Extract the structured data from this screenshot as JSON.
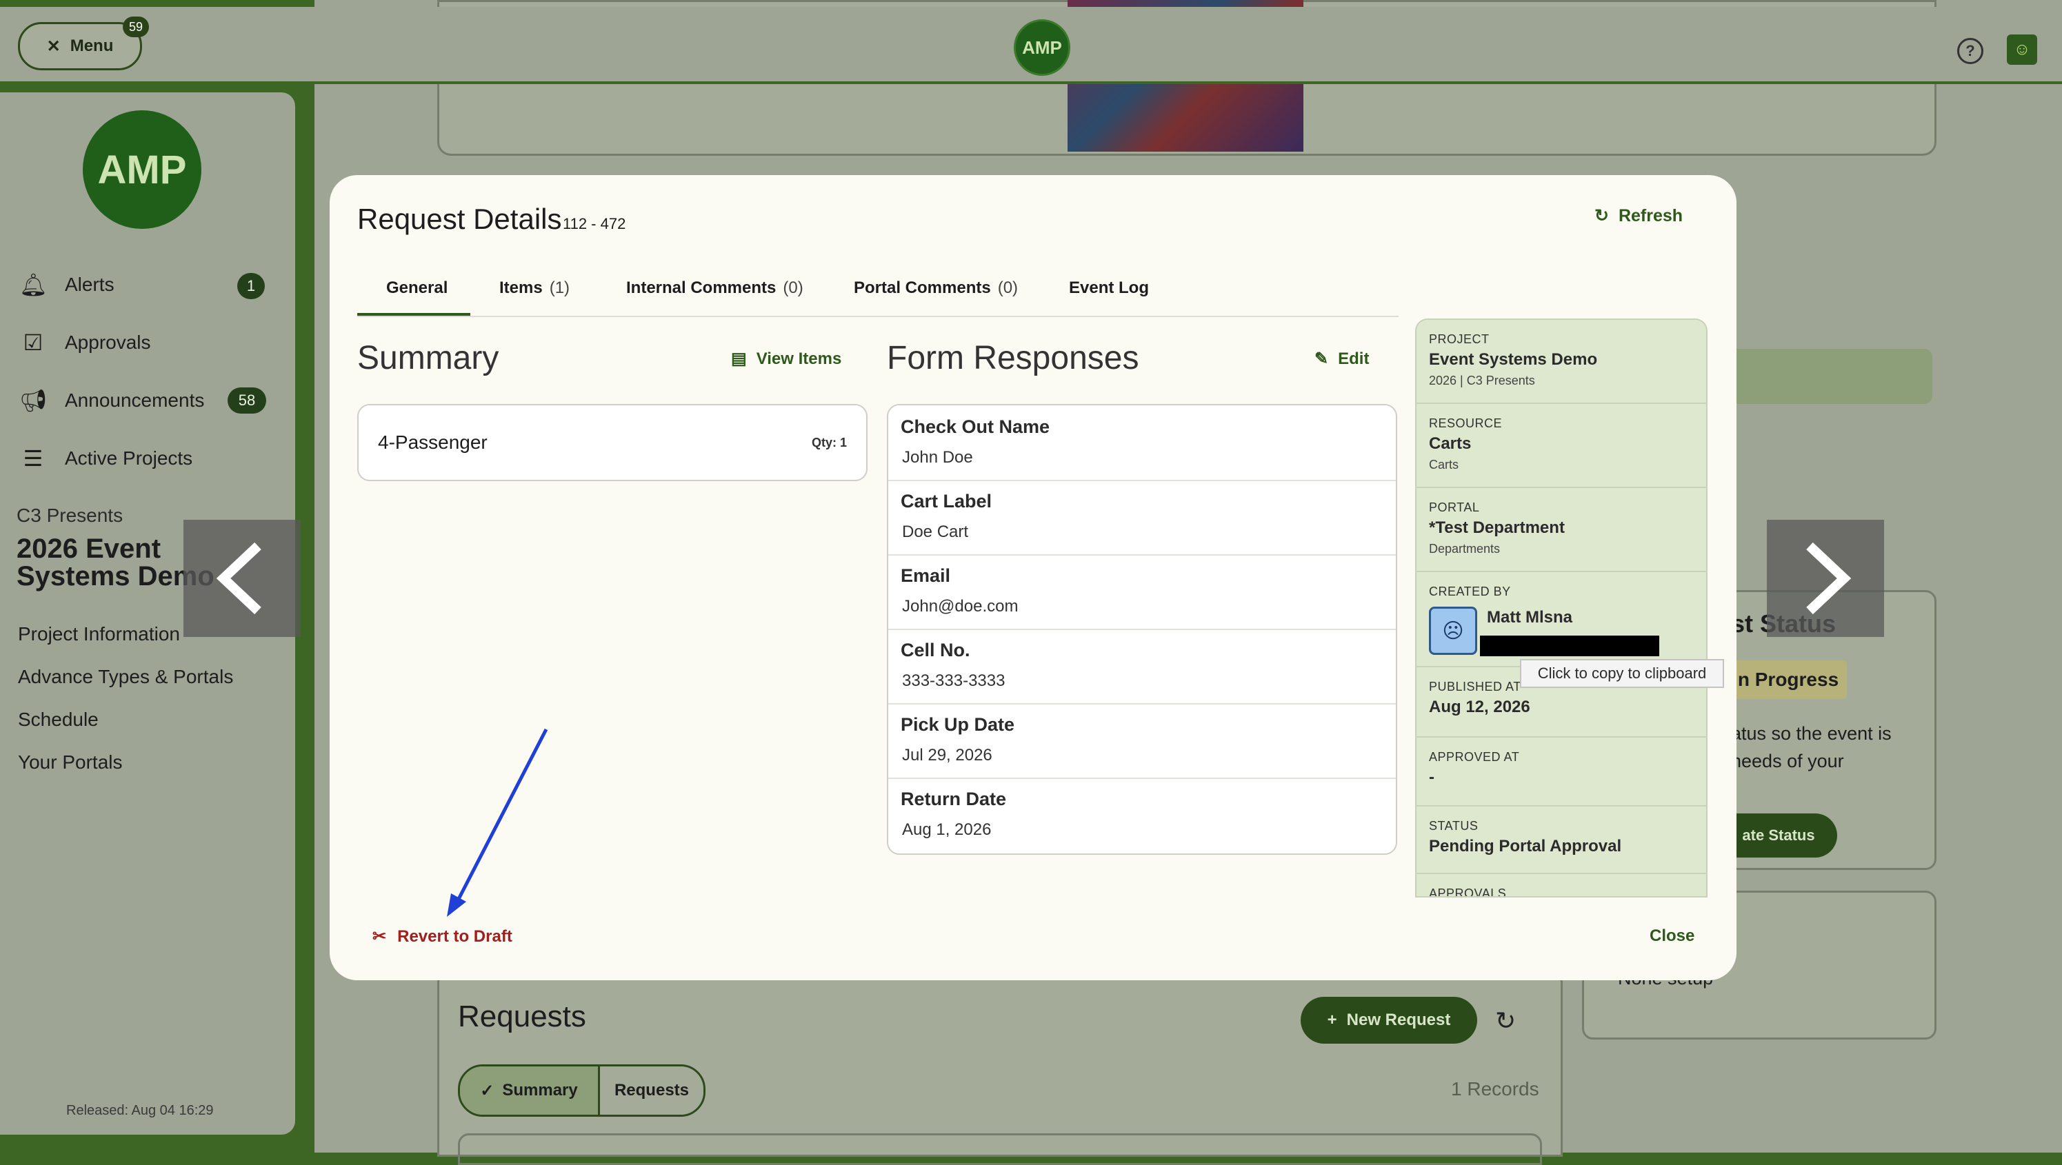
{
  "topbar": {
    "menu_label": "Menu",
    "menu_badge": "59",
    "logo_text": "AMP",
    "help_icon": "question-circle-icon"
  },
  "sidebar": {
    "logo_text": "AMP",
    "nav": [
      {
        "label": "Alerts",
        "icon": "bell-icon",
        "badge": "1"
      },
      {
        "label": "Approvals",
        "icon": "calendar-check-icon",
        "badge": ""
      },
      {
        "label": "Announcements",
        "icon": "megaphone-icon",
        "badge": "58"
      },
      {
        "label": "Active Projects",
        "icon": "list-icon",
        "badge": ""
      }
    ],
    "project_org": "C3 Presents",
    "project_name": "2026 Event Systems Demo",
    "project_nav": [
      "Project Information",
      "Advance Types & Portals",
      "Schedule",
      "Your Portals"
    ],
    "released": "Released: Aug 04 16:29"
  },
  "background": {
    "status_title": "st Status",
    "status_pill": "n Progress",
    "status_text": "atus so the event is needs of your",
    "update_button": "ate Status",
    "none_setup": "None setup",
    "requests_title": "Requests",
    "new_request": "New Request",
    "seg_summary": "Summary",
    "seg_requests": "Requests",
    "records": "1 Records"
  },
  "modal": {
    "title": "Request Details",
    "id": "112 - 472",
    "refresh": "Refresh",
    "tabs": [
      {
        "label": "General",
        "count": ""
      },
      {
        "label": "Items",
        "count": "(1)"
      },
      {
        "label": "Internal Comments",
        "count": "(0)"
      },
      {
        "label": "Portal Comments",
        "count": "(0)"
      },
      {
        "label": "Event Log",
        "count": ""
      }
    ],
    "summary": {
      "title": "Summary",
      "view_items": "View Items",
      "item_name": "4-Passenger",
      "item_qty": "Qty: 1"
    },
    "form": {
      "title": "Form Responses",
      "edit": "Edit",
      "rows": [
        {
          "label": "Check Out Name",
          "value": "John Doe"
        },
        {
          "label": "Cart Label",
          "value": "Doe Cart"
        },
        {
          "label": "Email",
          "value": "John@doe.com"
        },
        {
          "label": "Cell No.",
          "value": "333-333-3333"
        },
        {
          "label": "Pick Up Date",
          "value": "Jul 29, 2026"
        },
        {
          "label": "Return Date",
          "value": "Aug 1, 2026"
        }
      ]
    },
    "info": {
      "project_label": "PROJECT",
      "project_value": "Event Systems Demo",
      "project_sub": "2026 | C3 Presents",
      "resource_label": "RESOURCE",
      "resource_value": "Carts",
      "resource_sub": "Carts",
      "portal_label": "PORTAL",
      "portal_value": "*Test Department",
      "portal_sub": "Departments",
      "created_label": "CREATED BY",
      "created_value": "Matt Mlsna",
      "published_label": "PUBLISHED AT",
      "published_value": "Aug 12, 2026",
      "approved_label": "APPROVED AT",
      "approved_value": "-",
      "status_label": "STATUS",
      "status_value": "Pending Portal Approval",
      "approvals_label": "APPROVALS"
    },
    "tooltip": "Click to copy to clipboard",
    "revert": "Revert to Draft",
    "close": "Close"
  },
  "colors": {
    "accent": "#2d5a1b",
    "danger": "#a31e1e",
    "annotation_arrow": "#1f3fd6"
  }
}
